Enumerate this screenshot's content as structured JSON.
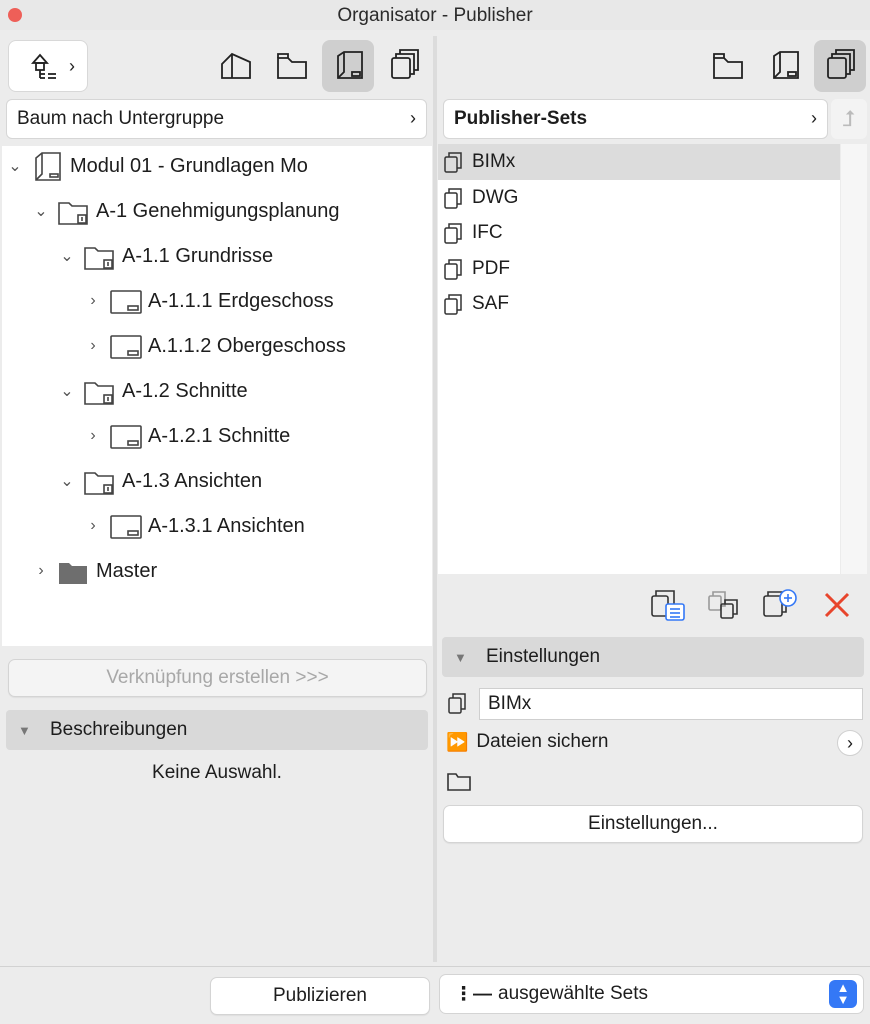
{
  "window": {
    "title": "Organisator - Publisher"
  },
  "left": {
    "view_dropdown": "Baum nach Untergruppe",
    "tree": [
      {
        "label": "Modul 01 - Grundlagen Mo",
        "expanded": true,
        "icon": "book-icon"
      },
      {
        "label": "A-1 Genehmigungsplanung",
        "expanded": true,
        "icon": "folder-icon"
      },
      {
        "label": "A-1.1 Grundrisse",
        "expanded": true,
        "icon": "folder-icon"
      },
      {
        "label": "A-1.1.1 Erdgeschoss",
        "expanded": false,
        "icon": "layout-icon"
      },
      {
        "label": "A.1.1.2 Obergeschoss",
        "expanded": false,
        "icon": "layout-icon"
      },
      {
        "label": "A-1.2 Schnitte",
        "expanded": true,
        "icon": "folder-icon"
      },
      {
        "label": "A-1.2.1 Schnitte",
        "expanded": false,
        "icon": "layout-icon"
      },
      {
        "label": "A-1.3 Ansichten",
        "expanded": true,
        "icon": "folder-icon"
      },
      {
        "label": "A-1.3.1 Ansichten",
        "expanded": false,
        "icon": "layout-icon"
      },
      {
        "label": "Master",
        "expanded": false,
        "icon": "dark-folder-icon"
      }
    ],
    "link_button": "Verknüpfung erstellen >>>",
    "descriptions_header": "Beschreibungen",
    "no_selection": "Keine Auswahl."
  },
  "right": {
    "sets_dropdown": "Publisher-Sets",
    "sets": [
      "BIMx",
      "DWG",
      "IFC",
      "PDF",
      "SAF"
    ],
    "selected_set": "BIMx",
    "settings_header": "Einstellungen",
    "set_name_value": "BIMx",
    "save_files_label": "Dateien sichern",
    "settings_button": "Einstellungen..."
  },
  "footer": {
    "publish_button": "Publizieren",
    "publish_mode": "ausgewählte Sets"
  },
  "colors": {
    "delete_accent": "#e8452c",
    "select_accent": "#3478f6"
  }
}
